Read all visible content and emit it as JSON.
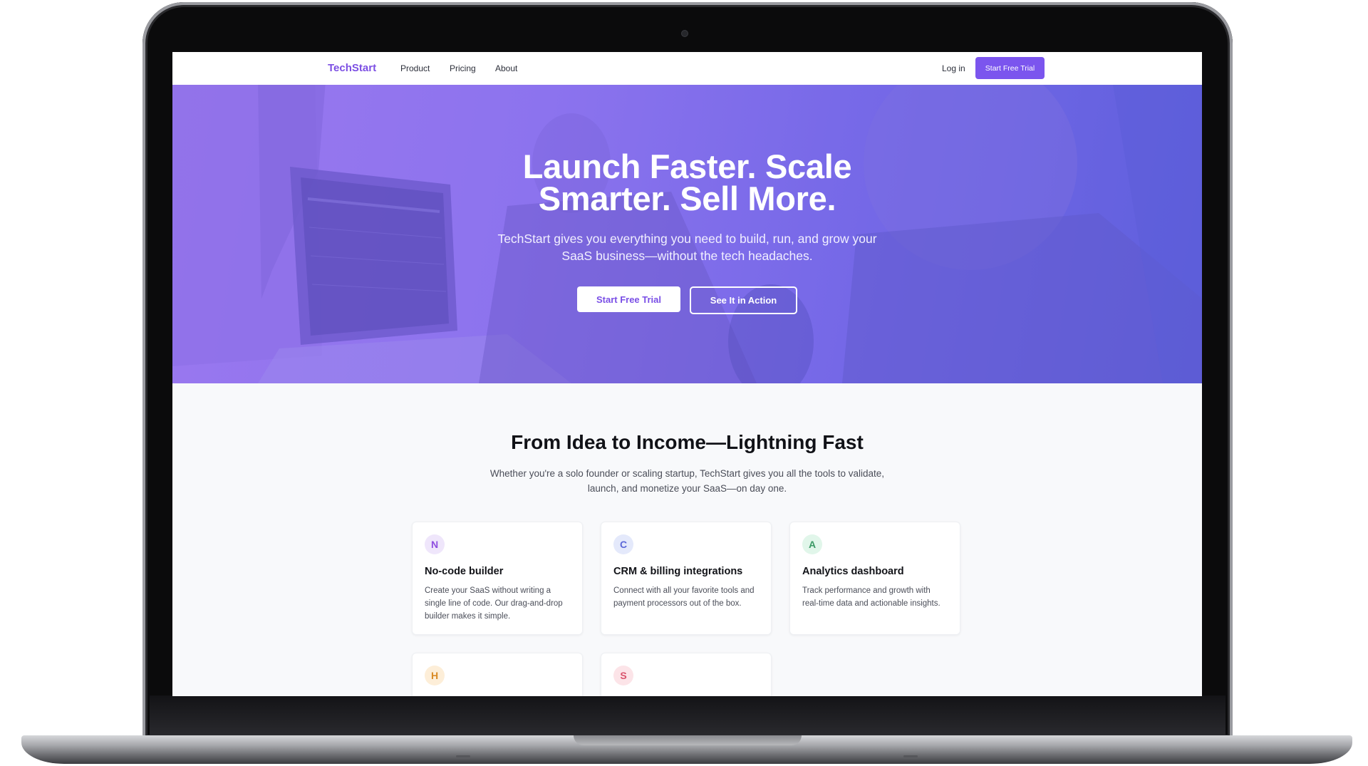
{
  "nav": {
    "brand": "TechStart",
    "links": [
      "Product",
      "Pricing",
      "About"
    ],
    "login": "Log in",
    "cta": "Start Free Trial"
  },
  "hero": {
    "title_line1": "Launch Faster. Scale",
    "title_line2": "Smarter. Sell More.",
    "subtitle": "TechStart gives you everything you need to build, run, and grow your SaaS business—without the tech headaches.",
    "primary_button": "Start Free Trial",
    "secondary_button": "See It in Action"
  },
  "features": {
    "title": "From Idea to Income—Lightning Fast",
    "subtitle": "Whether you're a solo founder or scaling startup, TechStart gives you all the tools to validate, launch, and monetize your SaaS—on day one.",
    "cards": [
      {
        "badge": "N",
        "title": "No-code builder",
        "desc": "Create your SaaS without writing a single line of code. Our drag-and-drop builder makes it simple.",
        "badge_bg": "#efe6fb",
        "badge_fg": "#8f4fe0"
      },
      {
        "badge": "C",
        "title": "CRM & billing integrations",
        "desc": "Connect with all your favorite tools and payment processors out of the box.",
        "badge_bg": "#e4e9fb",
        "badge_fg": "#5d68d8"
      },
      {
        "badge": "A",
        "title": "Analytics dashboard",
        "desc": "Track performance and growth with real-time data and actionable insights.",
        "badge_bg": "#e1f6ea",
        "badge_fg": "#3c9a66"
      },
      {
        "badge": "H",
        "title": "",
        "desc": "",
        "badge_bg": "#fdeed8",
        "badge_fg": "#d98b25"
      },
      {
        "badge": "S",
        "title": "",
        "desc": "",
        "badge_bg": "#fce4e8",
        "badge_fg": "#d9536c"
      }
    ]
  },
  "colors": {
    "accent": "#7b55ee",
    "hero_gradient_start": "#9a78ef",
    "hero_gradient_end": "#5e5fdc"
  }
}
